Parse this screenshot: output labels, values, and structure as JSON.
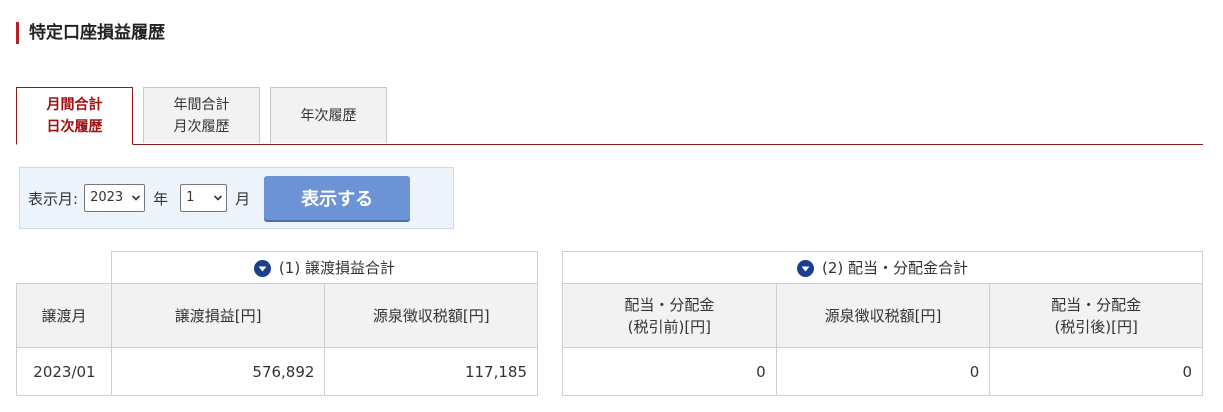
{
  "page": {
    "title": "特定口座損益履歴"
  },
  "tabs": [
    {
      "line1": "月間合計",
      "line2": "日次履歴"
    },
    {
      "line1": "年間合計",
      "line2": "月次履歴"
    },
    {
      "line1": "年次履歴",
      "line2": ""
    }
  ],
  "filter": {
    "label": "表示月:",
    "year_value": "2023",
    "year_unit": "年",
    "month_value": "1",
    "month_unit": "月",
    "submit_label": "表示する"
  },
  "table1": {
    "caption": "(1) 譲渡損益合計",
    "headers": [
      "譲渡月",
      "譲渡損益[円]",
      "源泉徴収税額[円]"
    ],
    "rows": [
      [
        "2023/01",
        "576,892",
        "117,185"
      ]
    ]
  },
  "table2": {
    "caption": "(2) 配当・分配金合計",
    "headers": [
      {
        "line1": "配当・分配金",
        "line2": "(税引前)[円]"
      },
      {
        "line1": "源泉徴収税額[円]",
        "line2": ""
      },
      {
        "line1": "配当・分配金",
        "line2": "(税引後)[円]"
      }
    ],
    "rows": [
      [
        "0",
        "0",
        "0"
      ]
    ]
  },
  "colors": {
    "accent": "#a01010",
    "button": "#6b93d6",
    "caption_icon": "#1a3f8f"
  }
}
